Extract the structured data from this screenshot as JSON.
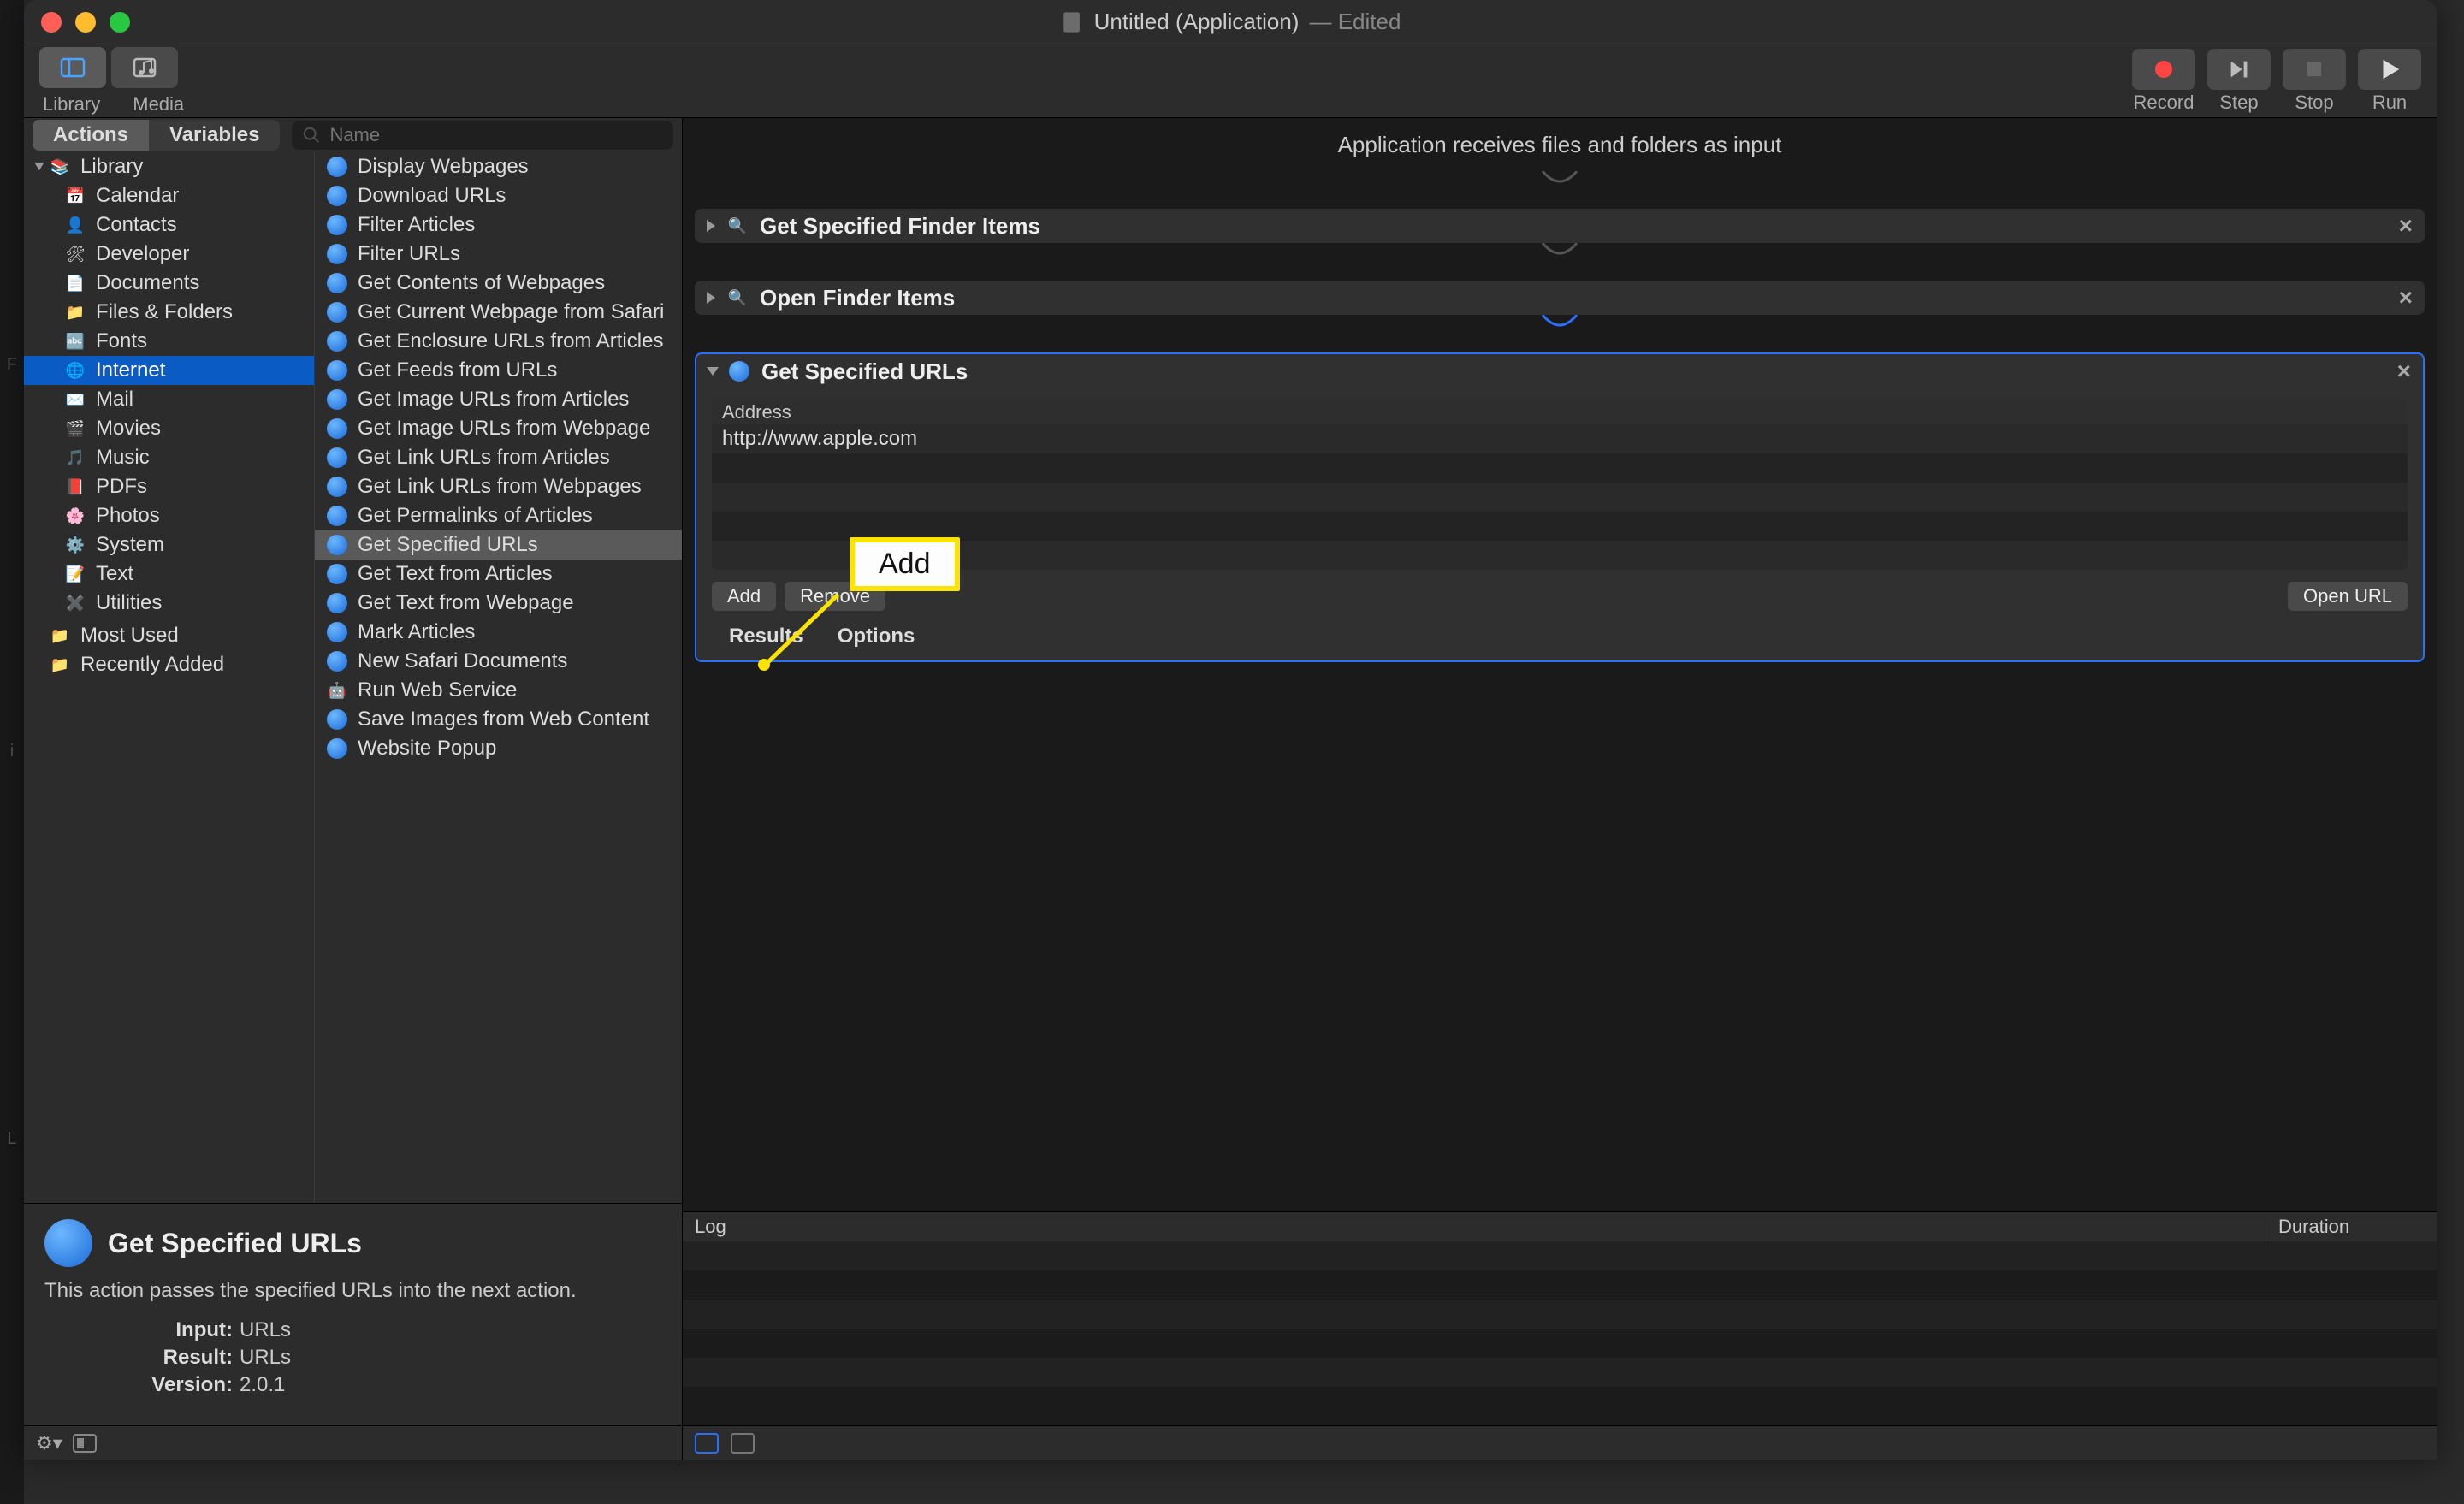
{
  "window": {
    "title": "Untitled (Application)",
    "edited": "— Edited"
  },
  "toolbar": {
    "library": "Library",
    "media": "Media",
    "record": "Record",
    "step": "Step",
    "stop": "Stop",
    "run": "Run"
  },
  "tabs": {
    "actions": "Actions",
    "variables": "Variables",
    "search_placeholder": "Name"
  },
  "library": {
    "root": "Library",
    "items": [
      "Calendar",
      "Contacts",
      "Developer",
      "Documents",
      "Files & Folders",
      "Fonts",
      "Internet",
      "Mail",
      "Movies",
      "Music",
      "PDFs",
      "Photos",
      "System",
      "Text",
      "Utilities"
    ],
    "footer1": "Most Used",
    "footer2": "Recently Added",
    "selected": "Internet"
  },
  "actions": [
    "Display Webpages",
    "Download URLs",
    "Filter Articles",
    "Filter URLs",
    "Get Contents of Webpages",
    "Get Current Webpage from Safari",
    "Get Enclosure URLs from Articles",
    "Get Feeds from URLs",
    "Get Image URLs from Articles",
    "Get Image URLs from Webpage",
    "Get Link URLs from Articles",
    "Get Link URLs from Webpages",
    "Get Permalinks of Articles",
    "Get Specified URLs",
    "Get Text from Articles",
    "Get Text from Webpage",
    "Mark Articles",
    "New Safari Documents",
    "Run Web Service",
    "Save Images from Web Content",
    "Website Popup"
  ],
  "actions_selected": "Get Specified URLs",
  "info": {
    "title": "Get Specified URLs",
    "desc": "This action passes the specified URLs into the next action.",
    "input_k": "Input:",
    "input_v": "URLs",
    "result_k": "Result:",
    "result_v": "URLs",
    "version_k": "Version:",
    "version_v": "2.0.1"
  },
  "workflow": {
    "input_text": "Application receives files and folders as input",
    "card1": "Get Specified Finder Items",
    "card2": "Open Finder Items",
    "card3": {
      "title": "Get Specified URLs",
      "col": "Address",
      "rows": [
        "http://www.apple.com",
        "",
        "",
        "",
        ""
      ],
      "add": "Add",
      "remove": "Remove",
      "open": "Open URL",
      "results": "Results",
      "options": "Options"
    }
  },
  "log": {
    "c1": "Log",
    "c2": "Duration"
  },
  "annotation": {
    "label": "Add"
  }
}
